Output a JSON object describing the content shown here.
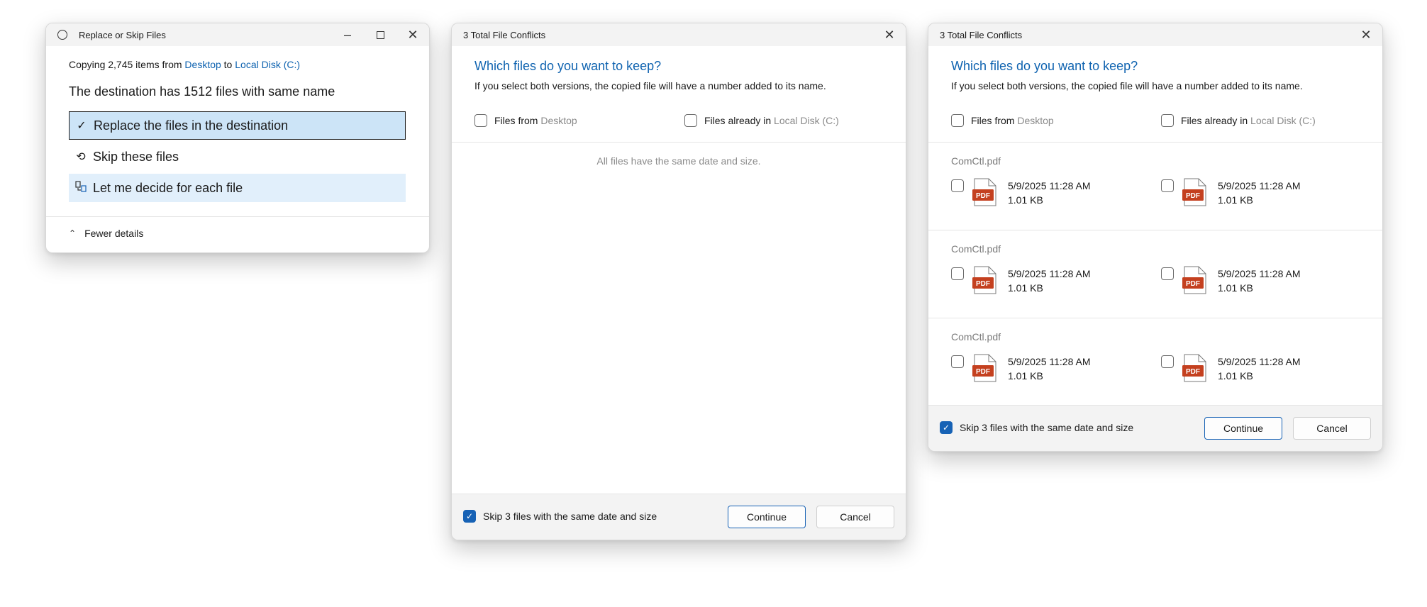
{
  "replace_dialog": {
    "title": "Replace or Skip Files",
    "copy_prefix": "Copying 2,745 items from",
    "copy_source": "Desktop",
    "copy_to": "to",
    "copy_dest": "Local Disk (C:)",
    "destination_message": "The destination has 1512 files with same name",
    "options": [
      {
        "label": "Replace the files in the destination",
        "icon": "checkmark-icon"
      },
      {
        "label": "Skip these files",
        "icon": "undo-arrow-icon"
      },
      {
        "label": "Let me decide for each file",
        "icon": "compare-files-icon"
      }
    ],
    "fewer_details": "Fewer details"
  },
  "conflicts_empty": {
    "title": "3 Total File Conflicts",
    "heading": "Which files do you want to keep?",
    "subtext": "If you select both versions, the copied file will have a number added to its name.",
    "files_from_label": "Files from",
    "files_from_location": "Desktop",
    "files_in_label": "Files already in",
    "files_in_location": "Local Disk (C:)",
    "empty_message": "All files have the same date and size.",
    "skip_label": "Skip 3 files with the same date and size",
    "skip_checked": true,
    "continue_label": "Continue",
    "cancel_label": "Cancel"
  },
  "conflicts_list": {
    "title": "3 Total File Conflicts",
    "heading": "Which files do you want to keep?",
    "subtext": "If you select both versions, the copied file will have a number added to its name.",
    "files_from_label": "Files from",
    "files_from_location": "Desktop",
    "files_in_label": "Files already in",
    "files_in_location": "Local Disk (C:)",
    "pdf_badge": "PDF",
    "items": [
      {
        "name": "ComCtl.pdf",
        "left": {
          "date": "5/9/2025 11:28 AM",
          "size": "1.01 KB"
        },
        "right": {
          "date": "5/9/2025 11:28 AM",
          "size": "1.01 KB"
        }
      },
      {
        "name": "ComCtl.pdf",
        "left": {
          "date": "5/9/2025 11:28 AM",
          "size": "1.01 KB"
        },
        "right": {
          "date": "5/9/2025 11:28 AM",
          "size": "1.01 KB"
        }
      },
      {
        "name": "ComCtl.pdf",
        "left": {
          "date": "5/9/2025 11:28 AM",
          "size": "1.01 KB"
        },
        "right": {
          "date": "5/9/2025 11:28 AM",
          "size": "1.01 KB"
        }
      }
    ],
    "skip_label": "Skip 3 files with the same date and size",
    "skip_checked": true,
    "continue_label": "Continue",
    "cancel_label": "Cancel"
  },
  "colors": {
    "accent": "#0f63b0",
    "selected_bg": "#cce4f7",
    "hover_bg": "#e1effb",
    "checkbox_on": "#1762b5",
    "pdf_red": "#c4401f"
  }
}
